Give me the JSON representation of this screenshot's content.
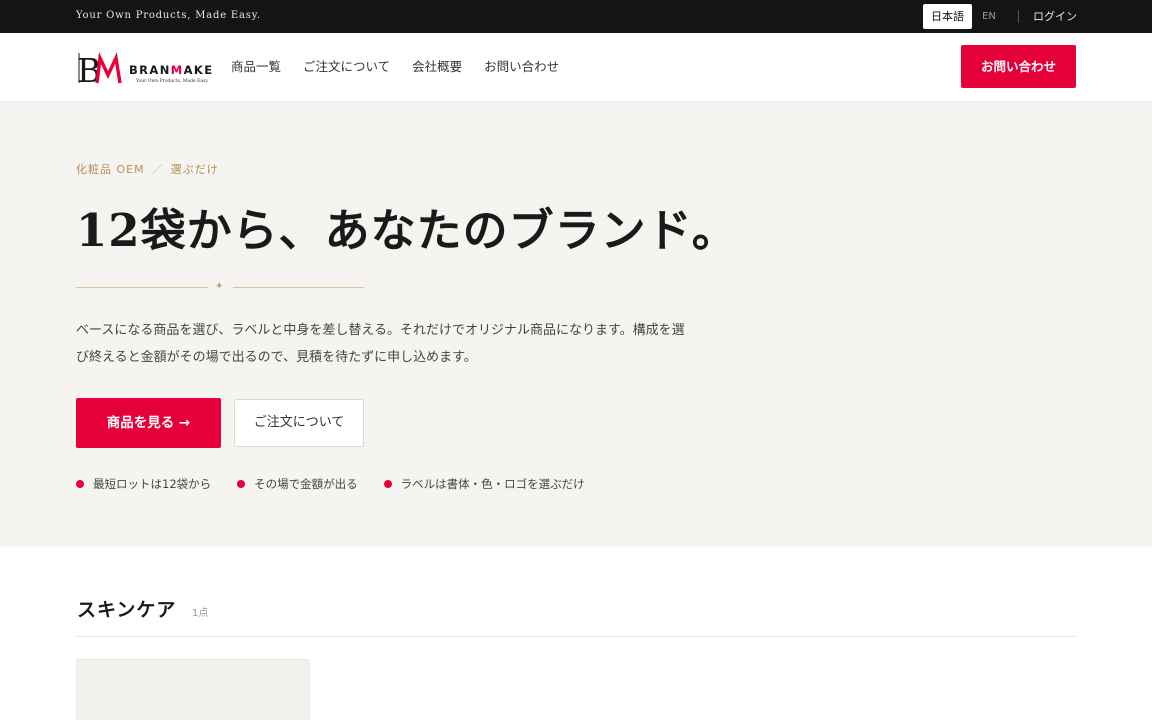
{
  "topbar": {
    "tagline": "Your Own Products, Made Easy.",
    "lang_ja": "日本語",
    "lang_en": "EN",
    "login": "ログイン"
  },
  "header": {
    "logo_word_1": "BRAN",
    "logo_word_2": "M",
    "logo_word_3": "AKE",
    "logo_sub": "Your Own Products, Made Easy.",
    "nav": [
      "商品一覧",
      "ご注文について",
      "会社概要",
      "お問い合わせ"
    ],
    "cta": "お問い合わせ"
  },
  "hero": {
    "eyebrow_1": "化粧品 OEM",
    "eyebrow_sep": "／",
    "eyebrow_2": "選ぶだけ",
    "title": "12袋から、あなたのブランド。",
    "ornament": "✦",
    "description": "ベースになる商品を選び、ラベルと中身を差し替える。それだけでオリジナル商品になります。構成を選び終えると金額がその場で出るので、見積を待たずに申し込めます。",
    "primary_button": "商品を見る →",
    "secondary_button": "ご注文について",
    "features": [
      "最短ロットは12袋から",
      "その場で金額が出る",
      "ラベルは書体・色・ロゴを選ぶだけ"
    ]
  },
  "section": {
    "title": "スキンケア",
    "count": "1点"
  },
  "colors": {
    "accent": "#e6003a",
    "topbar": "#141414",
    "hero_bg": "#f6f4f1",
    "gold": "#b98c55"
  }
}
